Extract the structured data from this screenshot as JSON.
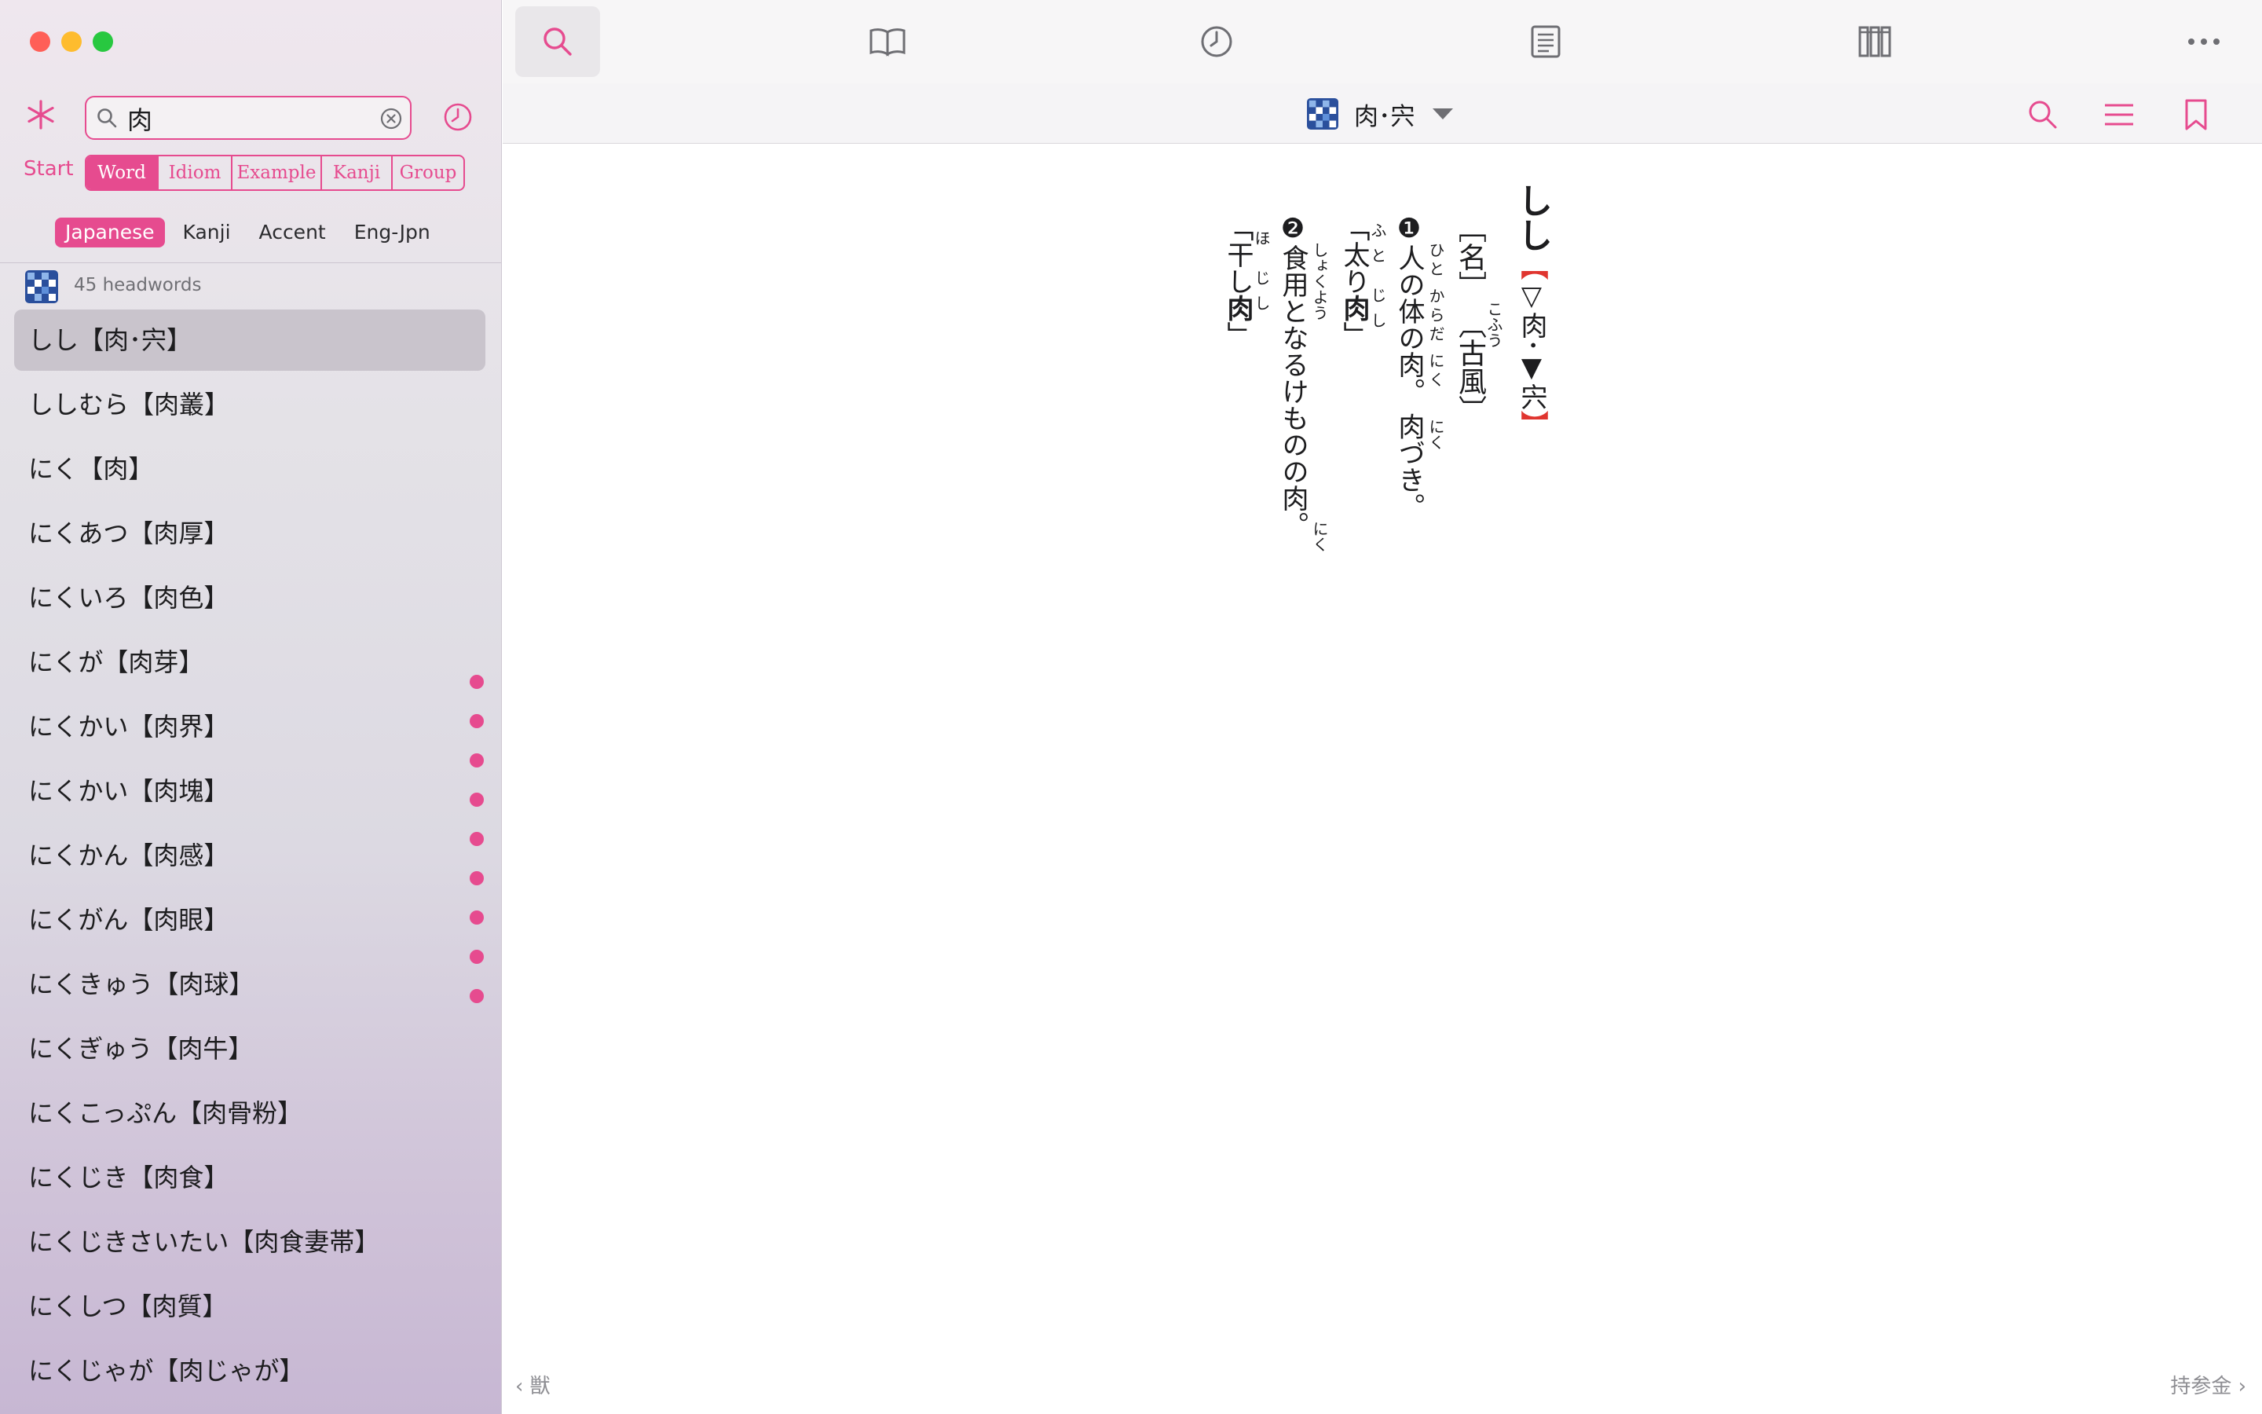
{
  "sidebar": {
    "search": {
      "value": "肉",
      "placeholder": ""
    },
    "start_label": "Start",
    "modes": [
      "Word",
      "Idiom",
      "Example",
      "Kanji",
      "Group"
    ],
    "active_mode": "Word",
    "sub_tabs": [
      "Japanese",
      "Kanji",
      "Accent",
      "Eng-Jpn"
    ],
    "active_sub_tab": "Japanese",
    "headword_count": "45 headwords",
    "items": [
      "しし【肉･宍】",
      "ししむら【肉叢】",
      "にく【肉】",
      "にくあつ【肉厚】",
      "にくいろ【肉色】",
      "にくが【肉芽】",
      "にくかい【肉界】",
      "にくかい【肉塊】",
      "にくかん【肉感】",
      "にくがん【肉眼】",
      "にくきゅう【肉球】",
      "にくぎゅう【肉牛】",
      "にくこっぷん【肉骨粉】",
      "にくじき【肉食】",
      "にくじきさいたい【肉食妻帯】",
      "にくしつ【肉質】",
      "にくじゃが【肉じゃが】"
    ],
    "selected_index": 0
  },
  "toolbar": {
    "icons": [
      "search-icon",
      "book-icon",
      "clock-icon",
      "document-icon",
      "library-icon",
      "more-icon"
    ],
    "active": "search-icon"
  },
  "entry": {
    "title": "肉･宍",
    "headword": "しし",
    "headword_kanji_open": "【",
    "headword_kanji": "▽肉･▼宍",
    "headword_kanji_close": "】",
    "pos": "［名］",
    "usage": "〔古風〕",
    "usage_ruby": "こふう",
    "sense1_num": "❶",
    "sense1_text": "人の体の肉。 肉づき。",
    "sense1_ruby_a": "ひと からだ にく",
    "sense1_ruby_b": "にく",
    "sense1_example_open": "「太り",
    "sense1_example_bold": "肉",
    "sense1_example_close": "」",
    "sense1_example_ruby": "ふと じし",
    "sense2_num": "❷",
    "sense2_text": "食用となるけものの肉。",
    "sense2_ruby_a": "しょくよう",
    "sense2_ruby_b": "にく",
    "sense2_example_open": "「干し",
    "sense2_example_bold": "肉",
    "sense2_example_close": "」",
    "sense2_example_ruby": "ほ じし"
  },
  "footer": {
    "prev": "獣",
    "next": "持参金"
  },
  "colors": {
    "accent": "#e64b8f",
    "headword_bracket": "#e0352f"
  }
}
